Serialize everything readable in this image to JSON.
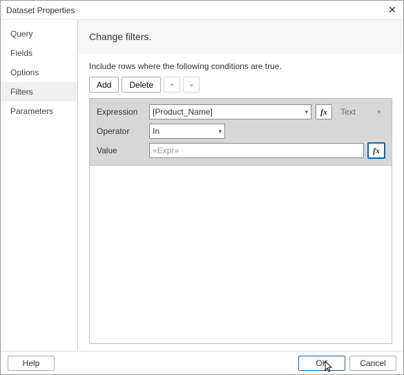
{
  "window": {
    "title": "Dataset Properties",
    "close_glyph": "✕"
  },
  "sidebar": {
    "items": [
      {
        "label": "Query"
      },
      {
        "label": "Fields"
      },
      {
        "label": "Options"
      },
      {
        "label": "Filters"
      },
      {
        "label": "Parameters"
      }
    ],
    "selected_index": 3
  },
  "page": {
    "heading": "Change filters.",
    "instruction": "Include rows where the following conditions are true.",
    "toolbar": {
      "add_label": "Add",
      "delete_label": "Delete"
    },
    "filter": {
      "expression_label": "Expression",
      "expression_value": "[Product_Name]",
      "type_value": "Text",
      "operator_label": "Operator",
      "operator_value": "In",
      "value_label": "Value",
      "value_placeholder": "«Expr»",
      "fx_glyph": "fx"
    }
  },
  "footer": {
    "help_label": "Help",
    "ok_label": "OK",
    "cancel_label": "Cancel"
  }
}
